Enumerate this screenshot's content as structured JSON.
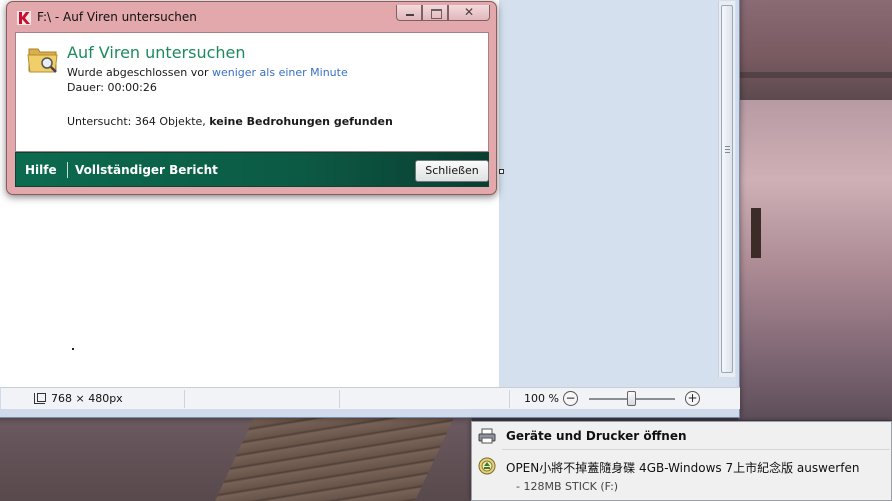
{
  "dialog": {
    "title": "F:\\ - Auf Viren untersuchen",
    "heading": "Auf Viren untersuchen",
    "completed_prefix": "Wurde abgeschlossen vor ",
    "completed_link": "weniger als einer Minute",
    "duration": "Dauer: 00:00:26",
    "scanned_prefix": "Untersucht: 364 Objekte, ",
    "scanned_result": "keine Bedrohungen gefunden",
    "help_link": "Hilfe",
    "report_link": "Vollständiger Bericht",
    "close_button": "Schließen",
    "close_x": "✕",
    "colors": {
      "heading": "#1c8a5e",
      "link": "#3a6fc4",
      "footer": "#0c6b4f"
    }
  },
  "paint": {
    "image_size": "768 × 480px",
    "zoom": "100 %",
    "zoom_out": "−",
    "zoom_in": "+"
  },
  "tray_menu": {
    "devices": "Geräte und Drucker öffnen",
    "eject": "OPEN小將不掉蓋隨身碟 4GB-Windows 7上市紀念版 auswerfen",
    "eject_sub": "-   128MB STICK (F:)"
  }
}
